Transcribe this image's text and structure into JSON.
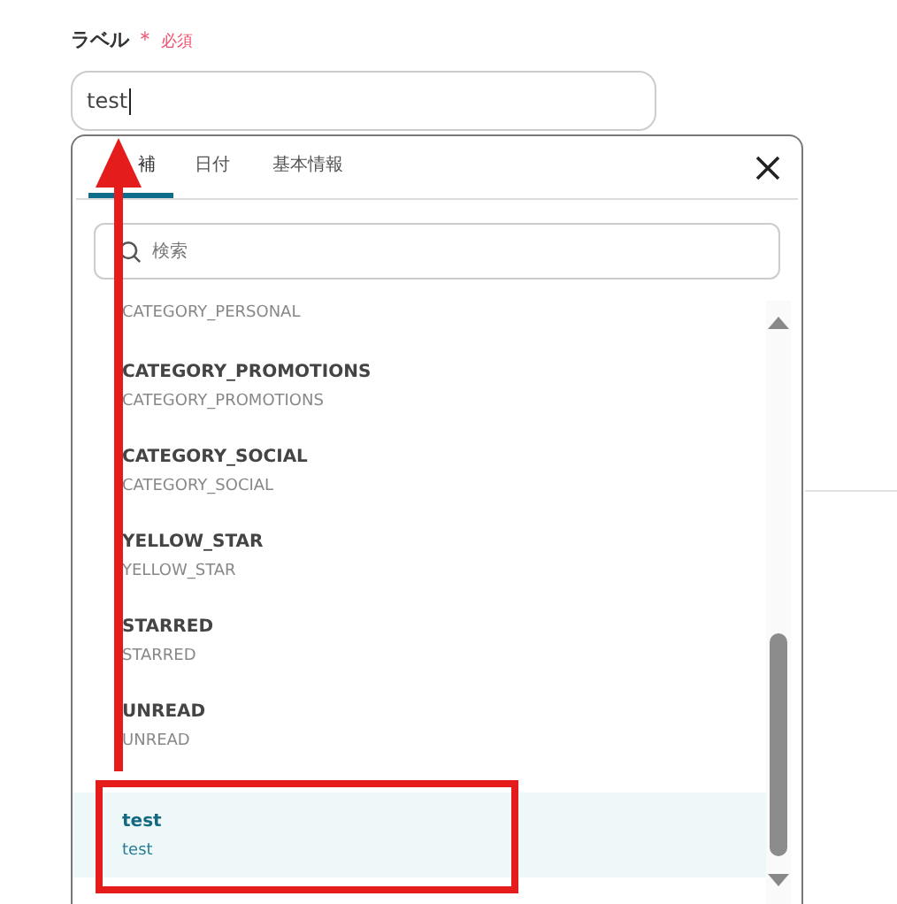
{
  "field": {
    "label": "ラベル",
    "required_mark": "＊",
    "required_text": "必須",
    "value": "test"
  },
  "popup": {
    "tabs": [
      {
        "label": "補",
        "selected": true
      },
      {
        "label": "日付",
        "selected": false
      },
      {
        "label": "基本情報",
        "selected": false
      }
    ],
    "search": {
      "placeholder": "検索"
    },
    "options": [
      {
        "value": "CATEGORY_PERSONAL",
        "selected": false
      },
      {
        "title": "CATEGORY_PROMOTIONS",
        "value": "CATEGORY_PROMOTIONS",
        "selected": false
      },
      {
        "title": "CATEGORY_SOCIAL",
        "value": "CATEGORY_SOCIAL",
        "selected": false
      },
      {
        "title": "YELLOW_STAR",
        "value": "YELLOW_STAR",
        "selected": false
      },
      {
        "title": "STARRED",
        "value": "STARRED",
        "selected": false
      },
      {
        "title": "UNREAD",
        "value": "UNREAD",
        "selected": false
      },
      {
        "title": "test",
        "value": "test",
        "selected": true
      }
    ]
  }
}
